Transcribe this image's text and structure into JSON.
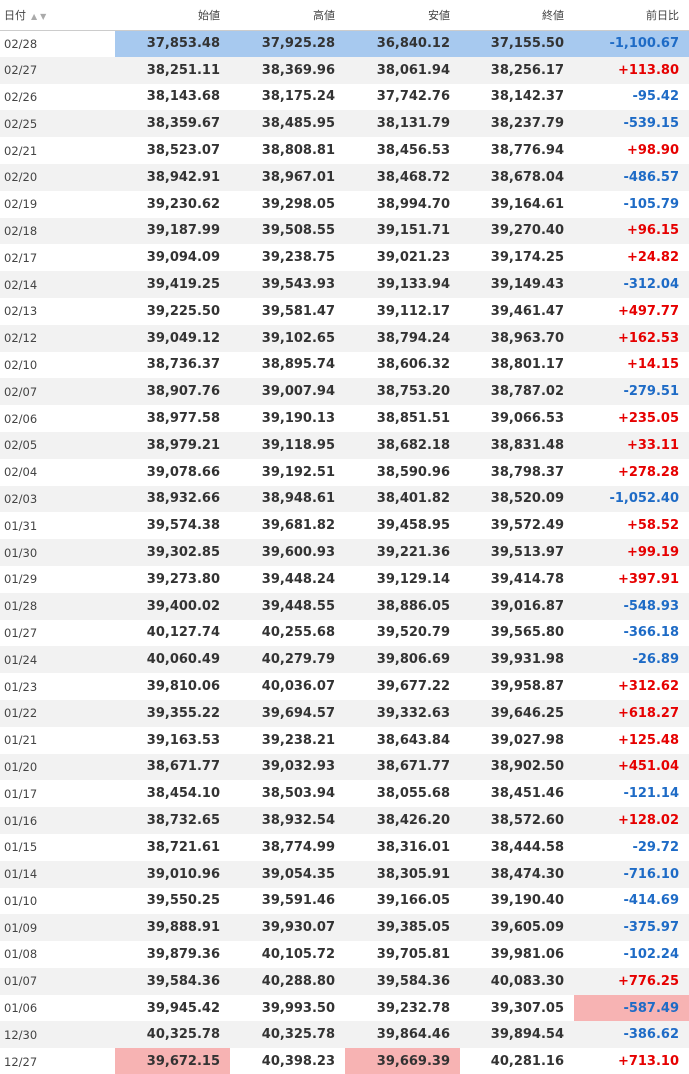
{
  "headers": {
    "date": "日付",
    "open": "始値",
    "high": "高値",
    "low": "安値",
    "close": "終値",
    "change": "前日比",
    "sort_up_icon": "▲",
    "sort_down_icon": "▼"
  },
  "colors": {
    "up": "#e60000",
    "down": "#1e6bc6",
    "selection": "#a7c9ef",
    "highlight": "#f7b3b3",
    "stripe": "#f2f2f2"
  },
  "rows": [
    {
      "date": "02/28",
      "open": "37,853.48",
      "high": "37,925.28",
      "low": "36,840.12",
      "close": "37,155.50",
      "change": "-1,100.67"
    },
    {
      "date": "02/27",
      "open": "38,251.11",
      "high": "38,369.96",
      "low": "38,061.94",
      "close": "38,256.17",
      "change": "+113.80"
    },
    {
      "date": "02/26",
      "open": "38,143.68",
      "high": "38,175.24",
      "low": "37,742.76",
      "close": "38,142.37",
      "change": "-95.42"
    },
    {
      "date": "02/25",
      "open": "38,359.67",
      "high": "38,485.95",
      "low": "38,131.79",
      "close": "38,237.79",
      "change": "-539.15"
    },
    {
      "date": "02/21",
      "open": "38,523.07",
      "high": "38,808.81",
      "low": "38,456.53",
      "close": "38,776.94",
      "change": "+98.90"
    },
    {
      "date": "02/20",
      "open": "38,942.91",
      "high": "38,967.01",
      "low": "38,468.72",
      "close": "38,678.04",
      "change": "-486.57"
    },
    {
      "date": "02/19",
      "open": "39,230.62",
      "high": "39,298.05",
      "low": "38,994.70",
      "close": "39,164.61",
      "change": "-105.79"
    },
    {
      "date": "02/18",
      "open": "39,187.99",
      "high": "39,508.55",
      "low": "39,151.71",
      "close": "39,270.40",
      "change": "+96.15"
    },
    {
      "date": "02/17",
      "open": "39,094.09",
      "high": "39,238.75",
      "low": "39,021.23",
      "close": "39,174.25",
      "change": "+24.82"
    },
    {
      "date": "02/14",
      "open": "39,419.25",
      "high": "39,543.93",
      "low": "39,133.94",
      "close": "39,149.43",
      "change": "-312.04"
    },
    {
      "date": "02/13",
      "open": "39,225.50",
      "high": "39,581.47",
      "low": "39,112.17",
      "close": "39,461.47",
      "change": "+497.77"
    },
    {
      "date": "02/12",
      "open": "39,049.12",
      "high": "39,102.65",
      "low": "38,794.24",
      "close": "38,963.70",
      "change": "+162.53"
    },
    {
      "date": "02/10",
      "open": "38,736.37",
      "high": "38,895.74",
      "low": "38,606.32",
      "close": "38,801.17",
      "change": "+14.15"
    },
    {
      "date": "02/07",
      "open": "38,907.76",
      "high": "39,007.94",
      "low": "38,753.20",
      "close": "38,787.02",
      "change": "-279.51"
    },
    {
      "date": "02/06",
      "open": "38,977.58",
      "high": "39,190.13",
      "low": "38,851.51",
      "close": "39,066.53",
      "change": "+235.05"
    },
    {
      "date": "02/05",
      "open": "38,979.21",
      "high": "39,118.95",
      "low": "38,682.18",
      "close": "38,831.48",
      "change": "+33.11"
    },
    {
      "date": "02/04",
      "open": "39,078.66",
      "high": "39,192.51",
      "low": "38,590.96",
      "close": "38,798.37",
      "change": "+278.28"
    },
    {
      "date": "02/03",
      "open": "38,932.66",
      "high": "38,948.61",
      "low": "38,401.82",
      "close": "38,520.09",
      "change": "-1,052.40"
    },
    {
      "date": "01/31",
      "open": "39,574.38",
      "high": "39,681.82",
      "low": "39,458.95",
      "close": "39,572.49",
      "change": "+58.52"
    },
    {
      "date": "01/30",
      "open": "39,302.85",
      "high": "39,600.93",
      "low": "39,221.36",
      "close": "39,513.97",
      "change": "+99.19"
    },
    {
      "date": "01/29",
      "open": "39,273.80",
      "high": "39,448.24",
      "low": "39,129.14",
      "close": "39,414.78",
      "change": "+397.91"
    },
    {
      "date": "01/28",
      "open": "39,400.02",
      "high": "39,448.55",
      "low": "38,886.05",
      "close": "39,016.87",
      "change": "-548.93"
    },
    {
      "date": "01/27",
      "open": "40,127.74",
      "high": "40,255.68",
      "low": "39,520.79",
      "close": "39,565.80",
      "change": "-366.18"
    },
    {
      "date": "01/24",
      "open": "40,060.49",
      "high": "40,279.79",
      "low": "39,806.69",
      "close": "39,931.98",
      "change": "-26.89"
    },
    {
      "date": "01/23",
      "open": "39,810.06",
      "high": "40,036.07",
      "low": "39,677.22",
      "close": "39,958.87",
      "change": "+312.62"
    },
    {
      "date": "01/22",
      "open": "39,355.22",
      "high": "39,694.57",
      "low": "39,332.63",
      "close": "39,646.25",
      "change": "+618.27"
    },
    {
      "date": "01/21",
      "open": "39,163.53",
      "high": "39,238.21",
      "low": "38,643.84",
      "close": "39,027.98",
      "change": "+125.48"
    },
    {
      "date": "01/20",
      "open": "38,671.77",
      "high": "39,032.93",
      "low": "38,671.77",
      "close": "38,902.50",
      "change": "+451.04"
    },
    {
      "date": "01/17",
      "open": "38,454.10",
      "high": "38,503.94",
      "low": "38,055.68",
      "close": "38,451.46",
      "change": "-121.14"
    },
    {
      "date": "01/16",
      "open": "38,732.65",
      "high": "38,932.54",
      "low": "38,426.20",
      "close": "38,572.60",
      "change": "+128.02"
    },
    {
      "date": "01/15",
      "open": "38,721.61",
      "high": "38,774.99",
      "low": "38,316.01",
      "close": "38,444.58",
      "change": "-29.72"
    },
    {
      "date": "01/14",
      "open": "39,010.96",
      "high": "39,054.35",
      "low": "38,305.91",
      "close": "38,474.30",
      "change": "-716.10"
    },
    {
      "date": "01/10",
      "open": "39,550.25",
      "high": "39,591.46",
      "low": "39,166.05",
      "close": "39,190.40",
      "change": "-414.69"
    },
    {
      "date": "01/09",
      "open": "39,888.91",
      "high": "39,930.07",
      "low": "39,385.05",
      "close": "39,605.09",
      "change": "-375.97"
    },
    {
      "date": "01/08",
      "open": "39,879.36",
      "high": "40,105.72",
      "low": "39,705.81",
      "close": "39,981.06",
      "change": "-102.24"
    },
    {
      "date": "01/07",
      "open": "39,584.36",
      "high": "40,288.80",
      "low": "39,584.36",
      "close": "40,083.30",
      "change": "+776.25"
    },
    {
      "date": "01/06",
      "open": "39,945.42",
      "high": "39,993.50",
      "low": "39,232.78",
      "close": "39,307.05",
      "change": "-587.49"
    },
    {
      "date": "12/30",
      "open": "40,325.78",
      "high": "40,325.78",
      "low": "39,864.46",
      "close": "39,894.54",
      "change": "-386.62"
    },
    {
      "date": "12/27",
      "open": "39,672.15",
      "high": "40,398.23",
      "low": "39,669.39",
      "close": "40,281.16",
      "change": "+713.10"
    }
  ],
  "selected_row": 0,
  "highlights": {
    "36": [
      "change"
    ],
    "38": [
      "open",
      "low"
    ],
    "39": [
      "high",
      "close"
    ]
  }
}
